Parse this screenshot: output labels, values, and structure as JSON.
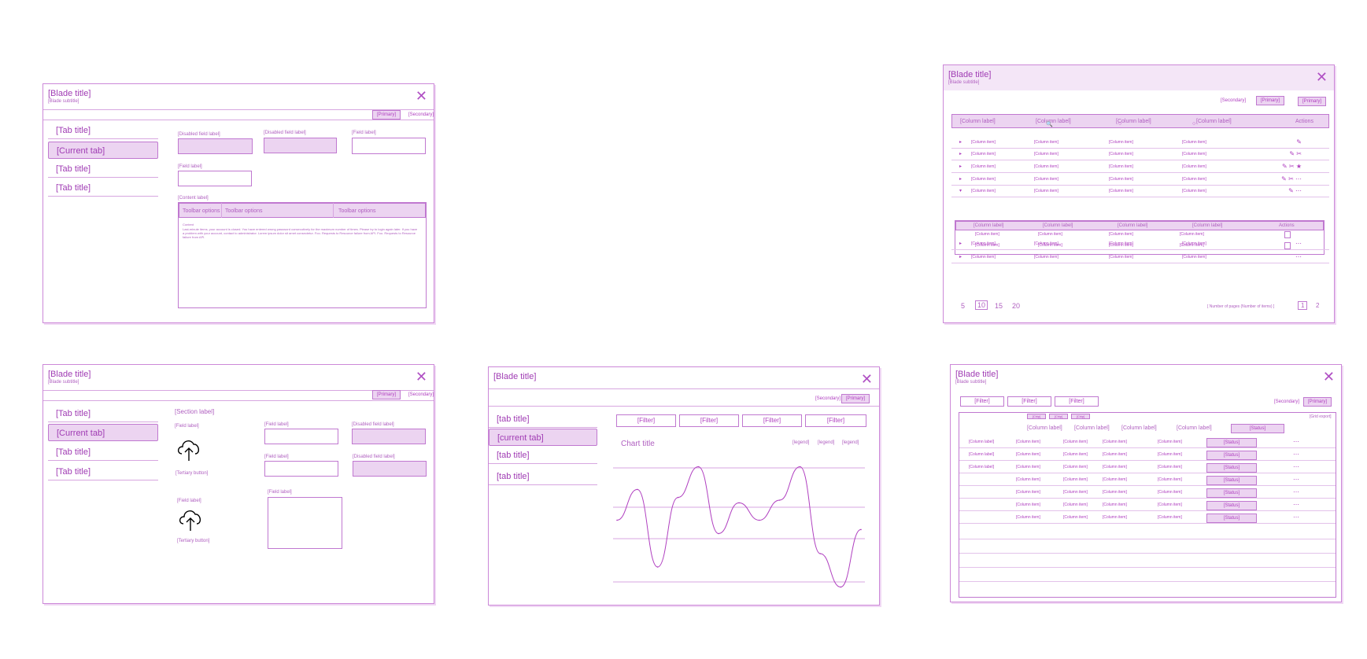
{
  "b1": {
    "title": "[Blade title]",
    "subtitle": "[Blade subtitle]",
    "primary": "[Primary]",
    "secondary": "[Secondary]",
    "tabs": [
      "[Tab title]",
      "[Current tab]",
      "[Tab title]",
      "[Tab title]"
    ],
    "disabled_label": "[Disabled field label]",
    "disabled_label2": "[Disabled field label]",
    "field_label": "[Field label]",
    "field_label2": "[Field label]",
    "content_label": "[Content label]",
    "toolbar": [
      "Toolbar options",
      "Toolbar options",
      "Toolbar options"
    ],
    "content_heading": "Content",
    "content_text": "Last-minute items, your account is closed. You have entered wrong password consecutively for the maximum number of times. Please try to login again later. If you have a problem with your account, contact to administrator. Lorem ipsum dolor sit amet consectetur. Foo. Requests to Resource failure from API. Foo. Requests to Resource failure from API."
  },
  "b2": {
    "title": "[Blade title]",
    "subtitle": "[Blade subtitle]",
    "secondary": "[Secondary]",
    "primary": "[Primary]",
    "columns": [
      "[Column label]",
      "[Column label]",
      "[Column label]",
      "[Column label]"
    ],
    "sort_filter": "Sort filter",
    "actions": "Actions",
    "cell": "[Column item]",
    "nested_columns": [
      "[Column label]",
      "[Column label]",
      "[Column label]",
      "[Column label]"
    ],
    "nested_actions": "Actions",
    "page_sizes": [
      "5",
      "10",
      "15",
      "20"
    ],
    "pager_text": "[ Number of pages (Number of items) ]",
    "pages": [
      "1",
      "2"
    ]
  },
  "b3": {
    "title": "[Blade title]",
    "subtitle": "[Blade subtitle]",
    "primary": "[Primary]",
    "secondary": "[Secondary]",
    "tabs": [
      "[Tab title]",
      "[Current tab]",
      "[Tab title]",
      "[Tab title]"
    ],
    "section_label": "[Section label]",
    "field_label_a": "[Field label]",
    "tertiary_a": "[Tertiary button]",
    "field_label_b": "[Field label]",
    "tertiary_b": "[Tertiary button]",
    "field_label_c": "[Field label]",
    "field_label_d": "[Field label]",
    "field_label_e": "[Field label]",
    "disabled_label_a": "[Disabled field label]",
    "disabled_label_b": "[Disabled field label]"
  },
  "b4": {
    "title": "[Blade title]",
    "secondary": "[Secondary]",
    "primary": "[Primary]",
    "tabs": [
      "[tab title]",
      "[current tab]",
      "[tab title]",
      "[tab title]"
    ],
    "filters": [
      "[Filter]",
      "[Filter]",
      "[Filter]",
      "[Filter]"
    ],
    "chart_title": "Chart title",
    "legend": [
      "[legend]",
      "[legend]",
      "[legend]"
    ]
  },
  "b5": {
    "title": "[Blade title]",
    "subtitle": "[Blade subtitle]",
    "filters": [
      "[Filter]",
      "[Filter]",
      "[Filter]"
    ],
    "secondary": "[Secondary]",
    "primary": "[Primary]",
    "chips": [
      "[Chip]",
      "[Chip]",
      "[Chip]"
    ],
    "grid_export": "[Grid export]",
    "columns": [
      "[Column label]",
      "[Column label]",
      "[Column label]",
      "[Column label]"
    ],
    "status_header": "[Status]",
    "row_label": "[Column label]",
    "cell": "[Column item]",
    "status": "[Status]"
  },
  "chart_data": {
    "type": "line",
    "title": "Chart title",
    "series": [
      {
        "values": [
          0.55,
          0.78,
          0.2,
          0.72,
          0.95,
          0.45,
          0.68,
          0.55,
          0.7,
          0.95,
          0.3,
          0.05,
          0.48
        ]
      }
    ],
    "grid": true,
    "legend": "top-right"
  },
  "colors": {
    "accent": "#b040c0",
    "fill": "#ecd4f1",
    "line": "#c078d0"
  }
}
